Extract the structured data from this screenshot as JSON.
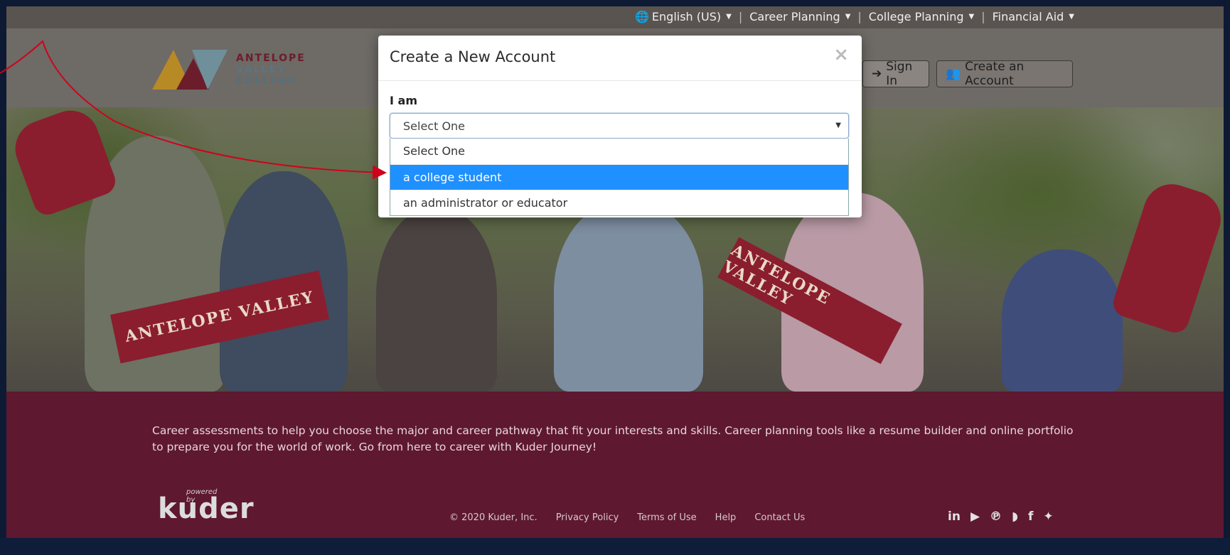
{
  "topbar": {
    "language": "English (US)",
    "career_planning": "Career Planning",
    "college_planning": "College Planning",
    "financial_aid": "Financial Aid"
  },
  "logo": {
    "line1": "ANTELOPE",
    "line2": "VALLEY",
    "line3": "COLLEGE"
  },
  "header": {
    "sign_in": "Sign In",
    "create_account": "Create an Account"
  },
  "hero": {
    "pennant1": "ANTELOPE VALLEY",
    "pennant2": "ANTELOPE VALLEY"
  },
  "modal": {
    "title": "Create a New Account",
    "close": "×",
    "field_label": "I am",
    "select_value": "Select One",
    "options": [
      "Select One",
      "a college student",
      "an administrator or educator"
    ],
    "selected_option": "a college student"
  },
  "band": {
    "text": "Career assessments to help you choose the major and career pathway that fit your interests and skills. Career planning tools like a resume builder and online portfolio to prepare you for the world of work. Go from here to career with Kuder Journey!"
  },
  "footer": {
    "powered_by": "powered by",
    "brand": "kuder",
    "copyright": "© 2020 Kuder, Inc.",
    "privacy": "Privacy Policy",
    "terms": "Terms of Use",
    "help": "Help",
    "contact": "Contact Us"
  },
  "colors": {
    "accent_blue": "#1e90ff",
    "maroon": "#5e1830",
    "annotation_red": "#d0021b"
  }
}
